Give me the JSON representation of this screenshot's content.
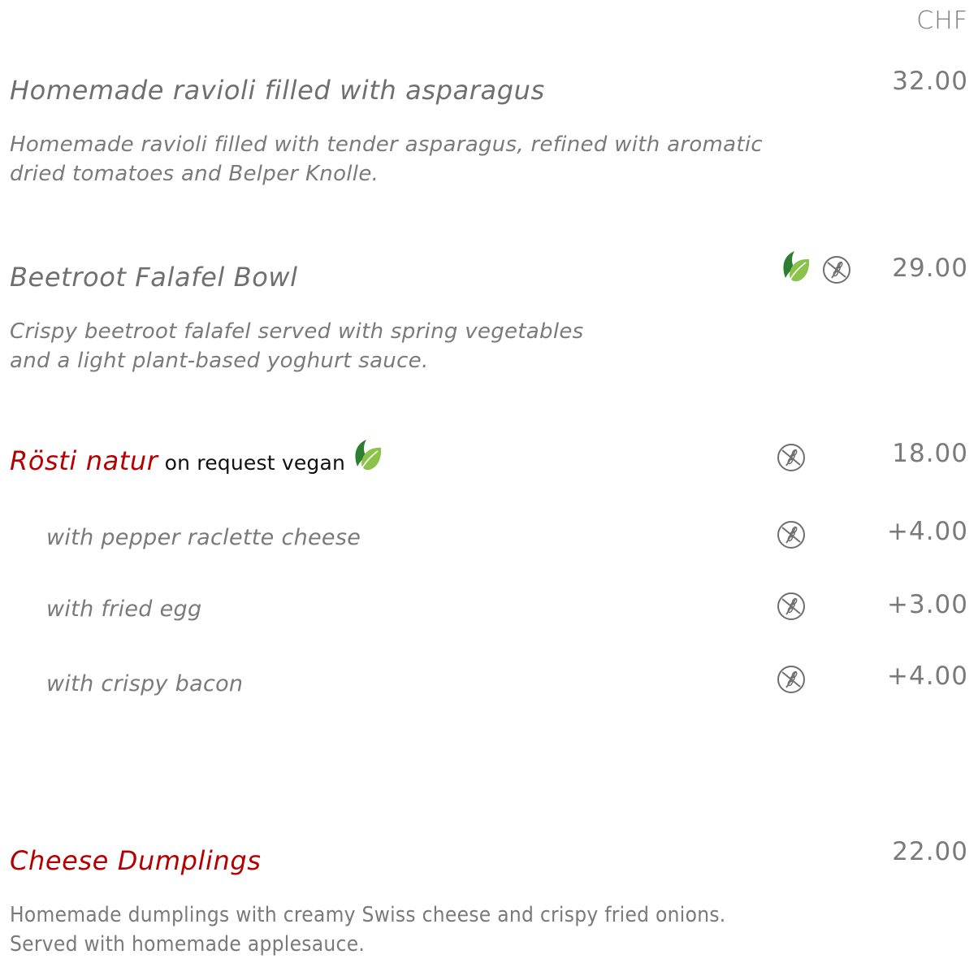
{
  "header": {
    "currency": "CHF"
  },
  "items": [
    {
      "title": "Homemade ravioli filled with asparagus",
      "price": "32.00",
      "description": [
        "Homemade ravioli filled with tender asparagus, refined with aromatic",
        "dried tomatoes and Belper Knolle."
      ]
    },
    {
      "title": "Beetroot Falafel Bowl",
      "price": "29.00",
      "icons": [
        "vegan-leaf-icon",
        "gluten-free-icon"
      ],
      "description": [
        "Crispy beetroot falafel served with spring vegetables",
        "and a light plant-based yoghurt sauce."
      ]
    },
    {
      "title": "Rösti natur",
      "note": "on request vegan",
      "price": "18.00",
      "icons": [
        "vegan-leaf-icon",
        "gluten-free-icon"
      ],
      "title_color": "#b40000",
      "options": [
        {
          "label": "with pepper raclette cheese",
          "price": "+4.00"
        },
        {
          "label": "with fried egg",
          "price": "+3.00"
        },
        {
          "label": "with crispy bacon",
          "price": "+4.00"
        }
      ]
    },
    {
      "title": "Cheese Dumplings",
      "price": "22.00",
      "title_color": "#b40000",
      "description": [
        "Homemade dumplings with creamy Swiss cheese and crispy fried onions.",
        "Served with homemade applesauce."
      ]
    }
  ],
  "colors": {
    "accent_red": "#b40000",
    "text_gray": "#6f6f6f",
    "leaf_dark": "#2e7d32",
    "leaf_light": "#8bc34a"
  }
}
